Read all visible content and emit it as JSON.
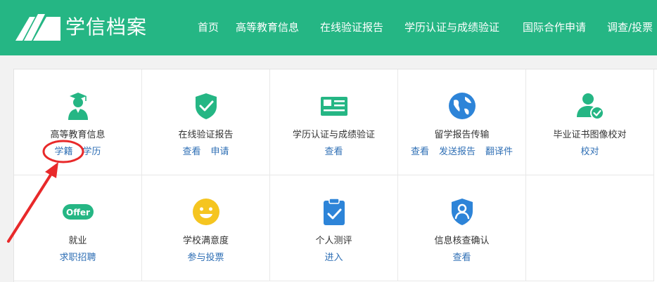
{
  "header": {
    "brand": "学信档案",
    "nav": [
      "首页",
      "高等教育信息",
      "在线验证报告",
      "学历认证与成绩验证",
      "国际合作申请",
      "调查/投票"
    ]
  },
  "cards": [
    {
      "icon": "graduate-icon",
      "title": "高等教育信息",
      "links": [
        "学籍",
        "学历"
      ]
    },
    {
      "icon": "shield-check-icon",
      "title": "在线验证报告",
      "links": [
        "查看",
        "申请"
      ]
    },
    {
      "icon": "certificate-card-icon",
      "title": "学历认证与成绩验证",
      "links": [
        "查看"
      ]
    },
    {
      "icon": "globe-icon",
      "title": "留学报告传输",
      "links": [
        "查看",
        "发送报告",
        "翻译件"
      ]
    },
    {
      "icon": "user-verified-icon",
      "title": "毕业证书图像校对",
      "links": [
        "校对"
      ]
    },
    {
      "icon": "offer-icon",
      "icon_text": "Offer",
      "title": "就业",
      "links": [
        "求职招聘"
      ]
    },
    {
      "icon": "smiley-icon",
      "title": "学校满意度",
      "links": [
        "参与投票"
      ]
    },
    {
      "icon": "clipboard-check-icon",
      "title": "个人测评",
      "links": [
        "进入"
      ]
    },
    {
      "icon": "shield-user-icon",
      "title": "信息核查确认",
      "links": [
        "查看"
      ]
    }
  ],
  "colors": {
    "header": "#25b684",
    "icon_green": "#25b684",
    "icon_blue": "#2d84d8",
    "icon_yellow": "#f5c520",
    "link": "#2f6fb5",
    "annotation": "#e8292a"
  }
}
